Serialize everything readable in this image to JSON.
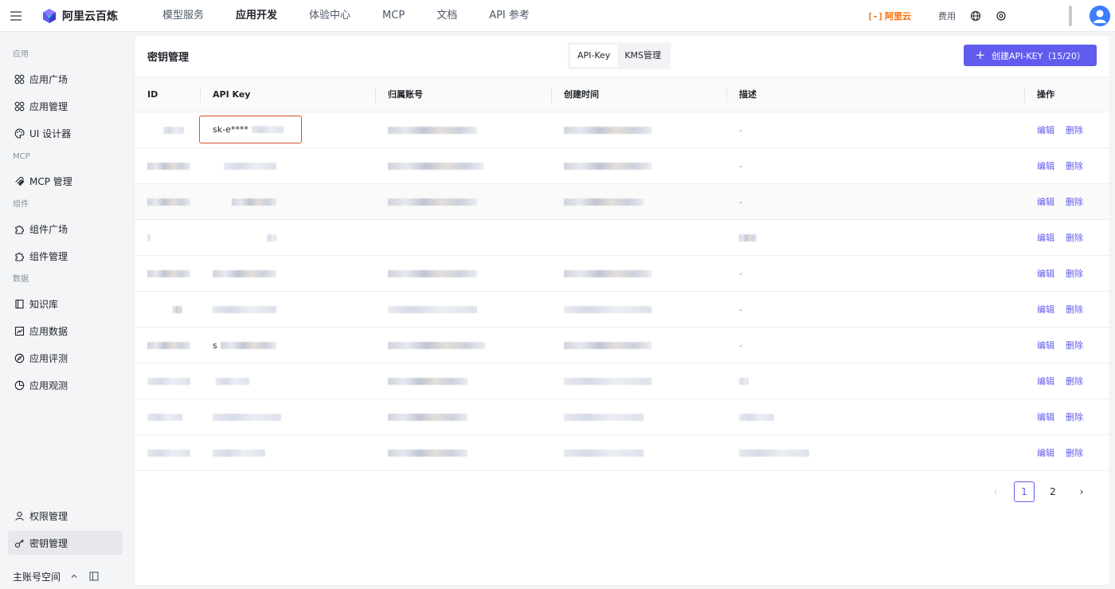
{
  "topbar": {
    "brand_name": "阿里云百炼",
    "nav": [
      "模型服务",
      "应用开发",
      "体验中心",
      "MCP",
      "文档",
      "API 参考"
    ],
    "active_nav_index": 1,
    "aliyun_logo_text": "阿里云",
    "aliyun_logo_bracket": "[-]",
    "fee_label": "费用"
  },
  "sidebar": {
    "groups": {
      "app": "应用",
      "mcp": "MCP",
      "component": "组件",
      "data": "数据"
    },
    "items": {
      "app_plaza": "应用广场",
      "app_manage": "应用管理",
      "ui_designer": "UI 设计器",
      "mcp_manage": "MCP 管理",
      "comp_plaza": "组件广场",
      "comp_manage": "组件管理",
      "knowledge": "知识库",
      "app_data": "应用数据",
      "app_eval": "应用评测",
      "app_observe": "应用观测",
      "permission": "权限管理",
      "key_manage": "密钥管理"
    },
    "workspace": "主账号空间"
  },
  "main": {
    "title": "密钥管理",
    "tabs": [
      "API-Key",
      "KMS管理"
    ],
    "active_tab": 0,
    "create_button": "创建API-KEY（15/20）"
  },
  "table": {
    "columns": [
      "ID",
      "API Key",
      "归属账号",
      "创建时间",
      "描述",
      "操作"
    ],
    "rows": [
      {
        "key_prefix": "sk-e****",
        "desc": "-"
      },
      {
        "key_prefix": "",
        "desc": "-"
      },
      {
        "key_prefix": "",
        "desc": "-"
      },
      {
        "key_prefix": "",
        "desc": ""
      },
      {
        "key_prefix": "",
        "desc": "-"
      },
      {
        "key_prefix": "",
        "desc": "-"
      },
      {
        "key_prefix": "s",
        "desc": "-"
      },
      {
        "key_prefix": "",
        "desc": ""
      },
      {
        "key_prefix": "",
        "desc": ""
      },
      {
        "key_prefix": "",
        "desc": ""
      }
    ],
    "edit_label": "编辑",
    "delete_label": "删除"
  },
  "pagination": {
    "pages": [
      "1",
      "2"
    ],
    "current": "1",
    "prev": "‹",
    "next": "›"
  }
}
